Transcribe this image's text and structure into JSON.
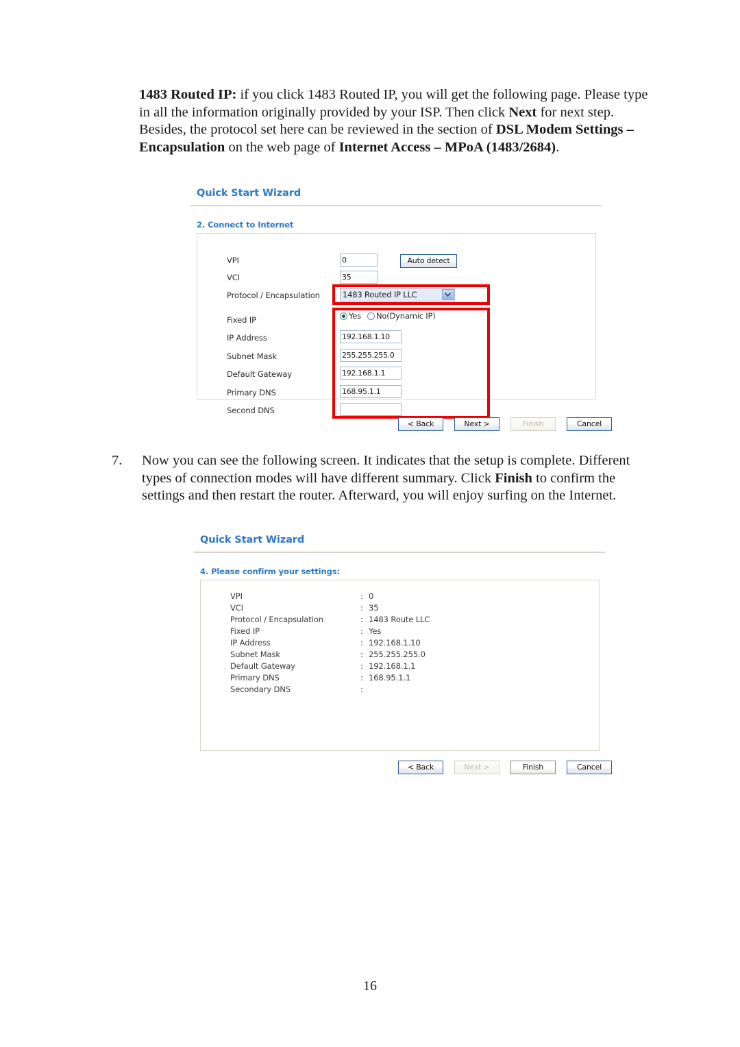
{
  "document": {
    "page_number": "16",
    "intro_paragraph": {
      "lead_bold": "1483 Routed IP:",
      "body_1": " if you click 1483 Routed IP, you will get the following page. Please type in all the information originally provided by your ISP. Then click ",
      "bold_1": "Next",
      "body_2": " for next step. Besides, the protocol set here can be reviewed in the section of ",
      "bold_2": "DSL Modem Settings – Encapsulation",
      "body_3": " on the web page of ",
      "bold_3": "Internet Access – MPoA (1483/2684)",
      "body_4": "."
    },
    "step_7": {
      "number": "7.",
      "body_1": "Now you can see the following screen. It indicates that the setup is complete. Different types of connection modes will have different summary. Click ",
      "bold_1": "Finish",
      "body_2": " to confirm the settings and then restart the router. Afterward, you will enjoy surfing on the Internet."
    }
  },
  "colors": {
    "heading_blue": "#2f78c4",
    "highlight_red": "#ee0000",
    "panel_border": "#d8d4c0",
    "input_border": "#9fb6cd"
  },
  "screenshot_step2": {
    "title": "Quick Start Wizard",
    "section_title": "2. Connect to Internet",
    "fields": {
      "vpi_label": "VPI",
      "vpi_value": "0",
      "vci_label": "VCI",
      "vci_value": "35",
      "protocol_label": "Protocol / Encapsulation",
      "protocol_value": "1483 Routed IP LLC",
      "auto_detect_label": "Auto detect",
      "fixed_ip_label": "Fixed IP",
      "fixed_ip_yes_label": "Yes",
      "fixed_ip_no_label": "No(Dynamic IP)",
      "fixed_ip_selected": "Yes",
      "ip_address_label": "IP Address",
      "ip_address_value": "192.168.1.10",
      "subnet_mask_label": "Subnet Mask",
      "subnet_mask_value": "255.255.255.0",
      "default_gateway_label": "Default Gateway",
      "default_gateway_value": "192.168.1.1",
      "primary_dns_label": "Primary DNS",
      "primary_dns_value": "168.95.1.1",
      "second_dns_label": "Second DNS",
      "second_dns_value": ""
    },
    "buttons": {
      "back": "< Back",
      "next": "Next >",
      "finish": "Finish",
      "cancel": "Cancel",
      "disabled": "finish"
    }
  },
  "screenshot_step4": {
    "title": "Quick Start Wizard",
    "section_title": "4. Please confirm your settings:",
    "summary": [
      {
        "label": "VPI",
        "separator": ":",
        "value": "0"
      },
      {
        "label": "VCI",
        "separator": ":",
        "value": "35"
      },
      {
        "label": "Protocol / Encapsulation",
        "separator": ":",
        "value": "1483 Route LLC"
      },
      {
        "label": "Fixed IP",
        "separator": ":",
        "value": "Yes"
      },
      {
        "label": "IP Address",
        "separator": ":",
        "value": "192.168.1.10"
      },
      {
        "label": "Subnet Mask",
        "separator": ":",
        "value": "255.255.255.0"
      },
      {
        "label": "Default Gateway",
        "separator": ":",
        "value": "192.168.1.1"
      },
      {
        "label": "Primary DNS",
        "separator": ":",
        "value": "168.95.1.1"
      },
      {
        "label": "Secondary DNS",
        "separator": ":",
        "value": ""
      }
    ],
    "buttons": {
      "back": "< Back",
      "next": "Next >",
      "finish": "Finish",
      "cancel": "Cancel",
      "disabled": "next"
    }
  }
}
